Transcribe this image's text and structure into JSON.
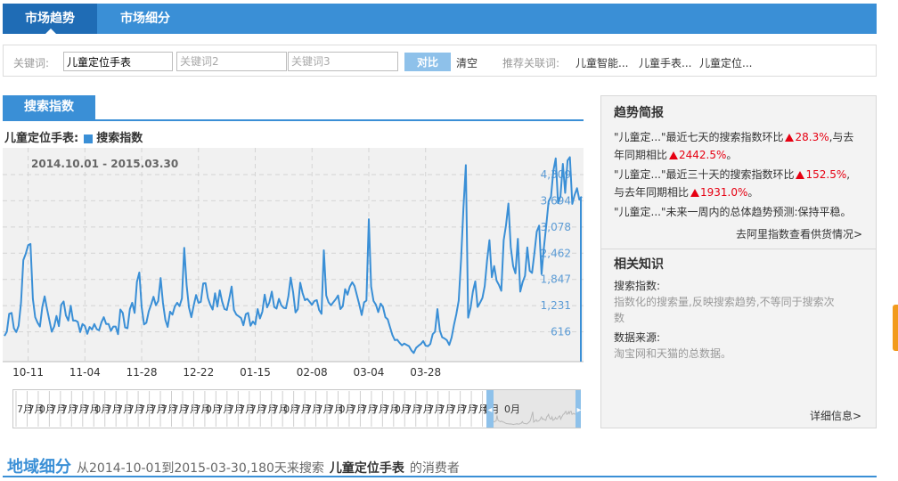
{
  "nav": {
    "tabs": [
      {
        "label": "市场趋势",
        "active": true
      },
      {
        "label": "市场细分",
        "active": false
      }
    ]
  },
  "keywords": {
    "label": "关键词:",
    "kw1_value": "儿童定位手表",
    "kw2_placeholder": "关键词2",
    "kw3_placeholder": "关键词3",
    "compare_label": "对比",
    "clear_label": "清空",
    "recommend_label": "推荐关联词:",
    "recommended": [
      "儿童智能...",
      "儿童手表...",
      "儿童定位..."
    ]
  },
  "section": {
    "tab_label": "搜索指数",
    "legend_keyword": "儿童定位手表:",
    "legend_series": "搜索指数"
  },
  "chart_data": {
    "type": "line",
    "date_range_label": "2014.10.01 - 2015.03.30",
    "x_tick_labels": [
      "10-11",
      "11-04",
      "11-28",
      "12-22",
      "01-15",
      "02-08",
      "03-04",
      "03-28"
    ],
    "y_tick_labels": [
      "616",
      "1,231",
      "1,847",
      "2,462",
      "3,078",
      "3,694",
      "4,309"
    ],
    "ylim": [
      0,
      4309
    ],
    "grid": true,
    "series": [
      {
        "name": "搜索指数",
        "color": "#3a8fd6",
        "values": [
          520,
          620,
          1040,
          1060,
          700,
          610,
          760,
          1300,
          2300,
          2450,
          2650,
          2680,
          1390,
          960,
          830,
          740,
          1200,
          1450,
          1150,
          880,
          620,
          740,
          990,
          750,
          1250,
          1330,
          1000,
          880,
          1230,
          880,
          880,
          850,
          610,
          800,
          750,
          570,
          730,
          670,
          800,
          680,
          650,
          840,
          960,
          800,
          800,
          640,
          740,
          740,
          560,
          1140,
          1060,
          720,
          700,
          1150,
          1300,
          1060,
          1790,
          2010,
          1200,
          790,
          830,
          1100,
          1260,
          1440,
          1240,
          1340,
          1880,
          1300,
          900,
          730,
          1090,
          1020,
          1210,
          1300,
          1220,
          1400,
          2590,
          1710,
          1190,
          960,
          1240,
          1480,
          1300,
          1320,
          1750,
          1760,
          1410,
          1250,
          1140,
          1520,
          1210,
          1590,
          1330,
          1150,
          1130,
          1390,
          1680,
          1130,
          1020,
          980,
          940,
          770,
          1030,
          1060,
          760,
          860,
          790,
          1150,
          930,
          1090,
          1490,
          1190,
          1310,
          1560,
          1200,
          1160,
          1390,
          1240,
          1180,
          1170,
          1450,
          1890,
          1550,
          1070,
          1150,
          1770,
          1530,
          1360,
          1390,
          1320,
          1250,
          1340,
          1360,
          1130,
          1040,
          2530,
          1470,
          1310,
          1240,
          1310,
          1380,
          1470,
          1150,
          1220,
          1620,
          1490,
          1680,
          1780,
          1690,
          1470,
          1250,
          1010,
          1310,
          1350,
          3260,
          1680,
          1340,
          1250,
          1080,
          1280,
          1200,
          960,
          910,
          720,
          540,
          420,
          430,
          360,
          300,
          340,
          310,
          280,
          180,
          120,
          240,
          290,
          330,
          400,
          290,
          280,
          330,
          560,
          620,
          1150,
          650,
          490,
          460,
          420,
          310,
          480,
          780,
          1030,
          1350,
          2330,
          3520,
          4530,
          950,
          1180,
          1560,
          1800,
          1200,
          1300,
          1410,
          1690,
          2310,
          2770,
          1900,
          2160,
          1820,
          1720,
          1580,
          2770,
          3120,
          3630,
          2610,
          2160,
          1990,
          2800,
          1560,
          1780,
          1930,
          2600,
          2050,
          2000,
          2470,
          2970,
          3110,
          1970,
          2590,
          3120,
          3680,
          3790,
          4390,
          4690,
          3640,
          3800,
          4560,
          3880,
          4640,
          4720,
          3620,
          3830,
          3990,
          3720,
          3790
        ]
      }
    ],
    "navigator_labels": [
      "7月",
      "7月",
      "0月",
      "7月",
      "7月",
      "7月",
      "7月",
      "0月",
      "7月",
      "7月",
      "7月",
      "7月",
      "7月",
      "7月",
      "7月",
      "7月",
      "7月",
      "0月",
      "7月",
      "7月",
      "7月",
      "7月",
      "7月",
      "7月",
      "0月",
      "7月",
      "7月",
      "7月",
      "7月",
      "0月",
      "7月",
      "7月",
      "7月",
      "7月",
      "0月",
      "7月",
      "7月",
      "7月",
      "7月",
      "7月",
      "7月",
      "7月",
      "0月"
    ],
    "navigator_selected_label": "0月"
  },
  "side": {
    "brief_title": "趋势简报",
    "brief1_a": "\"儿童定...\"最近七天的搜索指数环比",
    "brief1_v1": "28.3%",
    "brief1_b": ",与去",
    "brief1_c": "年同期相比",
    "brief1_v2": "2442.5%",
    "brief1_end": "。",
    "brief2_a": "\"儿童定...\"最近三十天的搜索指数环比",
    "brief2_v1": "152.5%",
    "brief2_b": ",",
    "brief2_c": "与去年同期相比",
    "brief2_v2": "1931.0%",
    "brief2_end": "。",
    "brief3": "\"儿童定...\"未来一周内的总体趋势预测:保持平稳。",
    "ali_link": "去阿里指数查看供货情况>",
    "knowledge_title": "相关知识",
    "k1_title": "搜索指数:",
    "k1_l1": "指数化的搜索量,反映搜索趋势,不等同于搜索次",
    "k1_l2": "数",
    "k2_title": "数据来源:",
    "k2_l1": "淘宝网和天猫的总数据。",
    "detail_link": "详细信息>"
  },
  "region": {
    "title": "地域细分",
    "prefix": "从2014-10-01到2015-03-30,180天来搜索",
    "keyword": "儿童定位手表",
    "suffix": "的消费者"
  }
}
